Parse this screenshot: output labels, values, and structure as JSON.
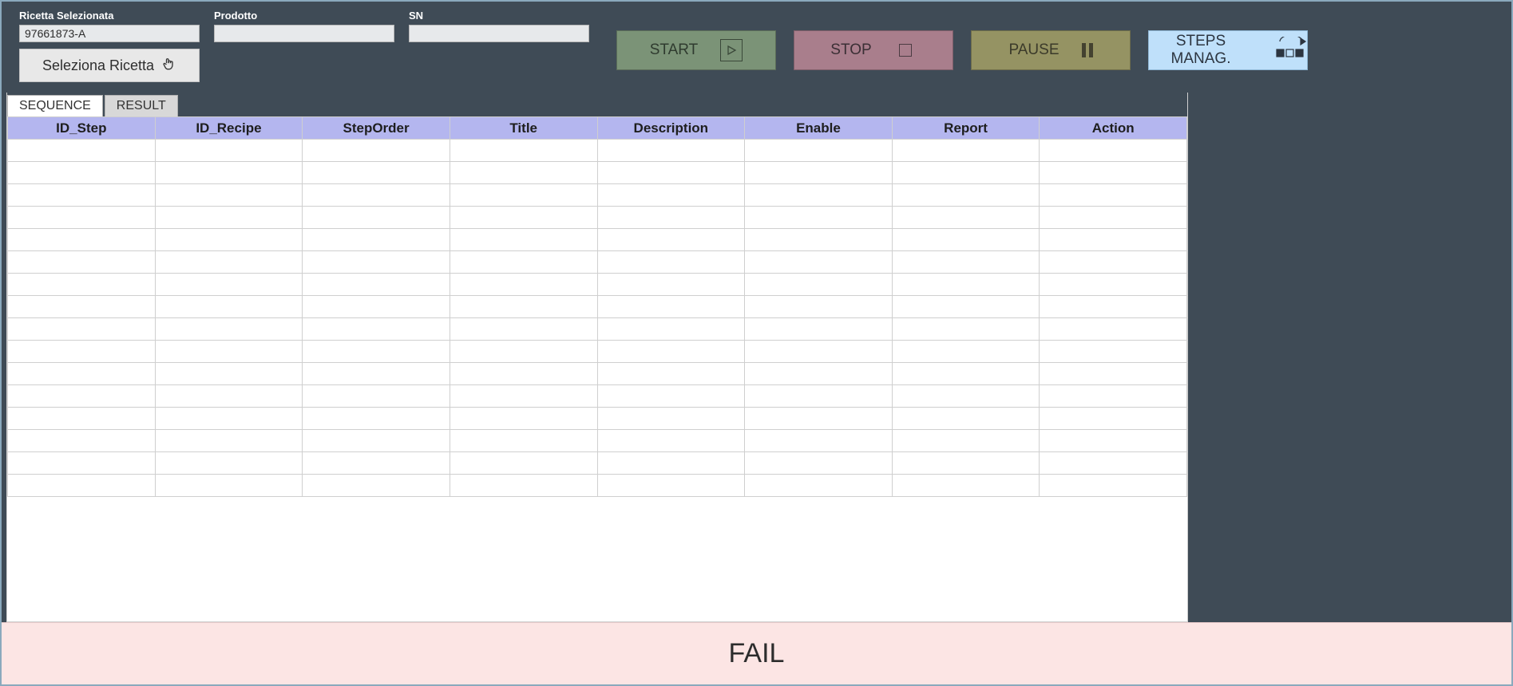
{
  "topbar": {
    "recipe_label": "Ricetta Selezionata",
    "recipe_value": "97661873-A",
    "product_label": "Prodotto",
    "product_value": "",
    "sn_label": "SN",
    "sn_value": "",
    "select_recipe_btn": "Seleziona Ricetta",
    "start_label": "START",
    "stop_label": "STOP",
    "pause_label": "PAUSE",
    "steps_label": "STEPS MANAG."
  },
  "tabs": {
    "sequence": "SEQUENCE",
    "result": "RESULT"
  },
  "grid": {
    "headers": {
      "idstep": "ID_Step",
      "idrecipe": "ID_Recipe",
      "steporder": "StepOrder",
      "title": "Title",
      "description": "Description",
      "enable": "Enable",
      "report": "Report",
      "action": "Action"
    },
    "row_count": 16
  },
  "status": {
    "text": "FAIL"
  }
}
